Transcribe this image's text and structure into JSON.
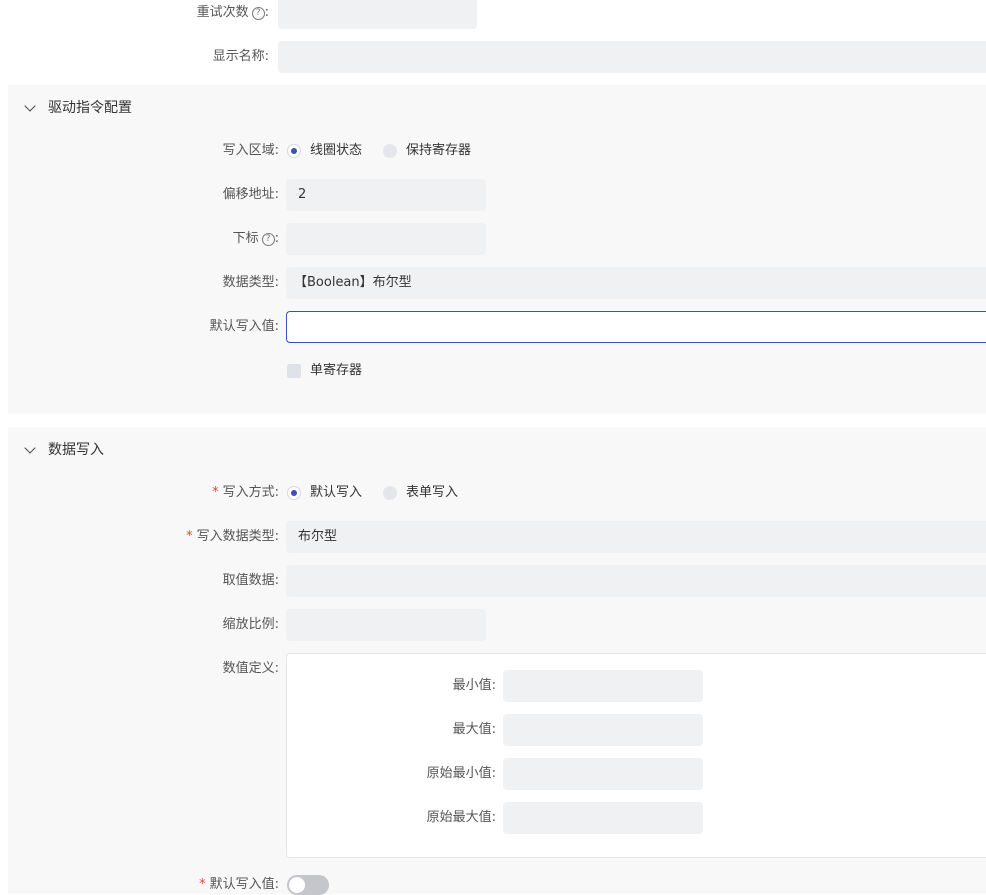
{
  "top": {
    "retry_label": "重试次数",
    "retry_value": "",
    "display_name_label": "显示名称:",
    "display_name_value": ""
  },
  "drive_section": {
    "title": "驱动指令配置",
    "write_area_label": "写入区域:",
    "write_area_options": [
      "线圈状态",
      "保持寄存器"
    ],
    "write_area_selected": "线圈状态",
    "offset_label": "偏移地址:",
    "offset_value": "2",
    "index_label": "下标",
    "index_value": "",
    "data_type_label": "数据类型:",
    "data_type_value": "【Boolean】布尔型",
    "default_write_label": "默认写入值:",
    "default_write_value": "",
    "single_register_label": "单寄存器",
    "single_register_checked": false
  },
  "data_write_section": {
    "title": "数据写入",
    "write_mode_label": "写入方式:",
    "write_mode_options": [
      "默认写入",
      "表单写入"
    ],
    "write_mode_selected": "默认写入",
    "write_data_type_label": "写入数据类型:",
    "write_data_type_value": "布尔型",
    "value_data_label": "取值数据:",
    "value_data_value": "",
    "scale_label": "缩放比例:",
    "scale_value": "",
    "value_def_label": "数值定义:",
    "value_def": {
      "min_label": "最小值:",
      "max_label": "最大值:",
      "raw_min_label": "原始最小值:",
      "raw_max_label": "原始最大值:"
    },
    "default_write_toggle_label": "默认写入值:",
    "default_write_toggle_on": false
  },
  "colors": {
    "accent": "#3d4fb8",
    "required": "#e0463b",
    "input_bg": "#f0f1f3",
    "section_bg": "#f8f8f8"
  }
}
